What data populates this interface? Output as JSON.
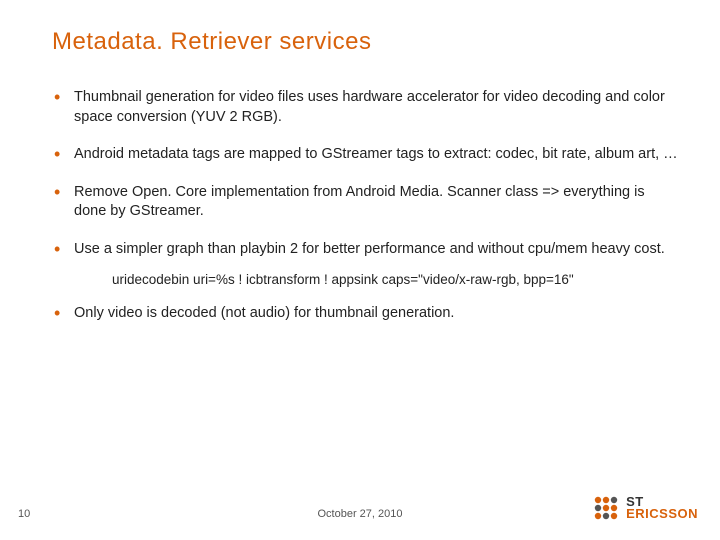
{
  "title": "Metadata. Retriever services",
  "bullets": {
    "b1": "Thumbnail generation for video files uses hardware accelerator for video decoding and color space conversion (YUV 2 RGB).",
    "b2": "Android metadata tags are mapped to GStreamer tags to extract: codec, bit rate, album art, …",
    "b3": "Remove Open. Core implementation from Android Media. Scanner class => everything is done by GStreamer.",
    "b4": "Use a simpler graph than playbin 2 for better performance and without cpu/mem heavy cost.",
    "b4_sub": "uridecodebin uri=%s ! icbtransform ! appsink caps=\"video/x-raw-rgb, bpp=16\"",
    "b5": "Only video is decoded (not audio) for thumbnail generation."
  },
  "footer": {
    "page": "10",
    "date": "October 27, 2010"
  },
  "logo": {
    "line1": "ST",
    "line2": "ERICSSON"
  }
}
